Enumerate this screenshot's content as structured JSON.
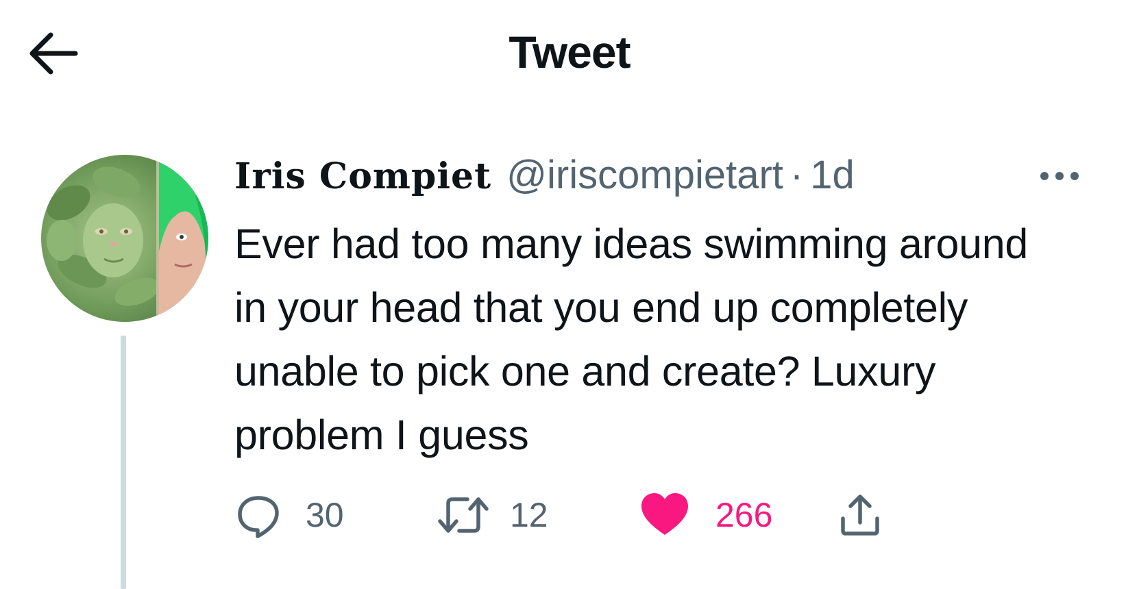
{
  "header": {
    "title": "Tweet",
    "back_icon": "arrow-left-icon"
  },
  "tweet": {
    "display_name": "Iris Compiet",
    "handle": "@iriscompietart",
    "separator": "·",
    "time": "1d",
    "more_icon": "more-horizontal-icon",
    "text": "Ever had too many ideas swimming around in your head that you end up completely unable to pick one and create? Luxury problem I guess",
    "actions": {
      "reply": {
        "icon": "reply-icon",
        "count": "30"
      },
      "retweet": {
        "icon": "retweet-icon",
        "count": "12"
      },
      "like": {
        "icon": "heart-icon",
        "count": "266",
        "liked": true
      },
      "share": {
        "icon": "share-icon"
      }
    }
  },
  "colors": {
    "text_primary": "#0f1419",
    "text_secondary": "#536471",
    "like_active": "#f91880",
    "thread_line": "#cfd9de"
  }
}
